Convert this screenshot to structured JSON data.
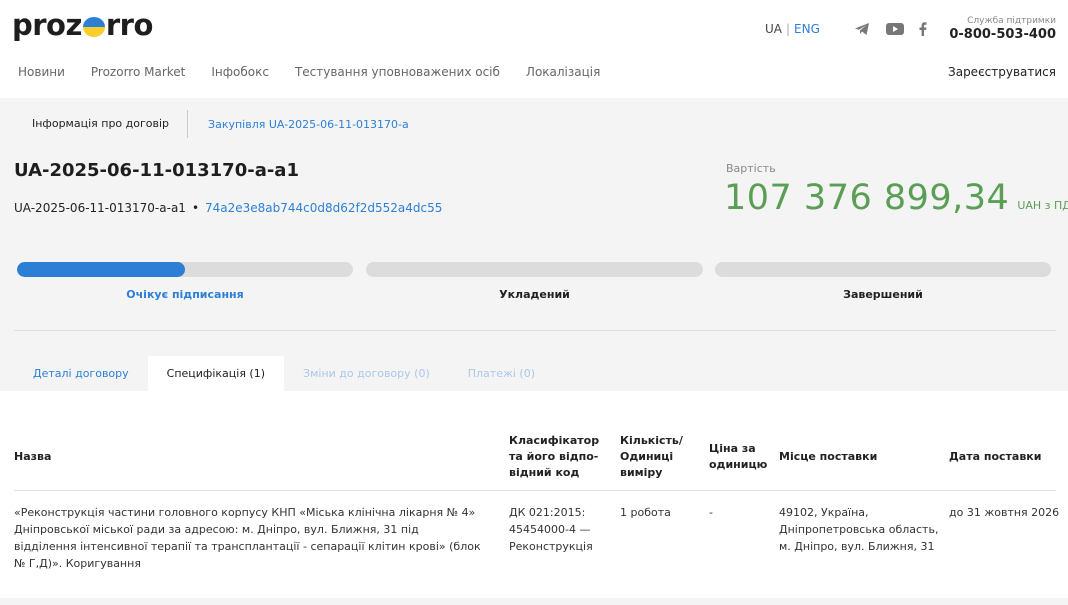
{
  "header": {
    "logo_left": "proz",
    "logo_right": "rro",
    "lang_ua": "UA",
    "lang_sep": "|",
    "lang_eng": "ENG",
    "social_icons": [
      "telegram-icon",
      "youtube-icon",
      "facebook-icon"
    ],
    "support_label": "Служба підтримки",
    "support_phone": "0-800-503-400"
  },
  "nav": {
    "items": [
      "Новини",
      "Prozorro Market",
      "Інфобокс",
      "Тестування уповноважених осіб",
      "Локалізація"
    ],
    "register": "Зареєструватися"
  },
  "subtabs": {
    "active": "Інформація про договір",
    "link": "Закупівля UA-2025-06-11-013170-a"
  },
  "contract": {
    "title": "UA-2025-06-11-013170-a-a1",
    "id": "UA-2025-06-11-013170-a-a1",
    "dot": "•",
    "hash": "74a2e3e8ab744c0d8d62f2d552a4dc55",
    "cost_label": "Вартість",
    "cost_amount": "107 376 899,34",
    "cost_currency": "UAH з ПДВ"
  },
  "progress": {
    "current_fraction": 0.5,
    "steps": [
      {
        "label": "Очікує підписання",
        "active": true
      },
      {
        "label": "Укладений",
        "active": false
      },
      {
        "label": "Завершений",
        "active": false
      }
    ]
  },
  "tabs": [
    {
      "label": "Деталі договору",
      "state": "link"
    },
    {
      "label": "Специфікація (1)",
      "state": "active"
    },
    {
      "label": "Зміни до договору (0)",
      "state": "disabled"
    },
    {
      "label": "Платежі (0)",
      "state": "disabled"
    }
  ],
  "table": {
    "headers": {
      "name": "Назва",
      "classifier": "Класифікатор та його відпо-відний код",
      "quantity": "Кількість/ Одиниці виміру",
      "price": "Ціна за одиницю",
      "place": "Місце поставки",
      "date": "Дата поставки"
    },
    "rows": [
      {
        "name": "«Реконструкція частини головного корпусу КНП «Міська клінічна лікарня № 4» Дніпровської міської ради за адресою: м. Дніпро, вул. Ближня, 31 під відділення інтенсивної терапії та трансплантації - сепарації клітин крові» (блок № Г,Д)». Коригування",
        "classifier": "ДК 021:2015: 45454000-4 — Реконструкція",
        "quantity": "1 робота",
        "price": "-",
        "place": "49102, Україна, Дніпропетровська область, м. Дніпро, вул. Ближня, 31",
        "date": "до 31 жовтня 2026"
      }
    ]
  }
}
